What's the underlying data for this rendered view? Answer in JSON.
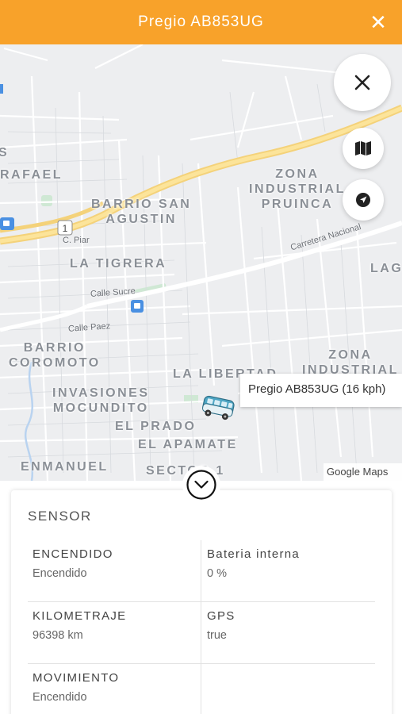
{
  "header": {
    "title": "Pregio AB853UG",
    "close_icon": "close-icon",
    "background_color": "#F8A22A"
  },
  "map": {
    "area_labels": [
      {
        "name": "rafael",
        "text": "RAFAEL"
      },
      {
        "name": "barrio-san-agustin",
        "text": "BARRIO SAN\nAGUSTIN"
      },
      {
        "name": "zona-industrial-pruinca",
        "text": "ZONA\nINDUSTRIAL\nPRUINCA"
      },
      {
        "name": "la-tigrera",
        "text": "LA TIGRERA"
      },
      {
        "name": "lag",
        "text": "LAG"
      },
      {
        "name": "barrio-coromoto",
        "text": "BARRIO\nCOROMOTO"
      },
      {
        "name": "zona-industrial",
        "text": "ZONA\nINDUSTRIAL"
      },
      {
        "name": "la-libertad",
        "text": "LA LIBERTAD"
      },
      {
        "name": "invasiones-mocundito",
        "text": "INVASIONES\nMOCUNDITO"
      },
      {
        "name": "el-prado",
        "text": "EL PRADO"
      },
      {
        "name": "el-apamate",
        "text": "EL APAMATE"
      },
      {
        "name": "enmanuel",
        "text": "ENMANUEL"
      },
      {
        "name": "sector-1",
        "text": "SECTOR 1"
      },
      {
        "name": "s-fragment",
        "text": "S"
      }
    ],
    "street_labels": [
      {
        "name": "c-piar",
        "text": "C. Piar"
      },
      {
        "name": "calle-sucre",
        "text": "Calle Sucre"
      },
      {
        "name": "calle-paez",
        "text": "Calle Paez"
      },
      {
        "name": "carretera-nacional",
        "text": "Carretera Nacional"
      }
    ],
    "route_shield": "1",
    "tooltip": "Pregio AB853UG (16 kph)",
    "attribution": "Google Maps",
    "buttons": {
      "close_icon": "close-icon",
      "layers_icon": "map-icon",
      "locate_icon": "navigation-icon"
    },
    "vehicle_icon": "van-icon",
    "transit_icon": "bus-stop-icon"
  },
  "collapse_icon": "chevron-down-circle-icon",
  "sensor": {
    "title": "SENSOR",
    "rows": [
      [
        {
          "label": "ENCENDIDO",
          "value": "Encendido"
        },
        {
          "label": "Bateria interna",
          "value": "0 %"
        }
      ],
      [
        {
          "label": "KILOMETRAJE",
          "value": "96398 km"
        },
        {
          "label": "GPS",
          "value": "true"
        }
      ],
      [
        {
          "label": "MOVIMIENTO",
          "value": "Encendido"
        },
        {
          "label": "",
          "value": ""
        }
      ]
    ]
  }
}
